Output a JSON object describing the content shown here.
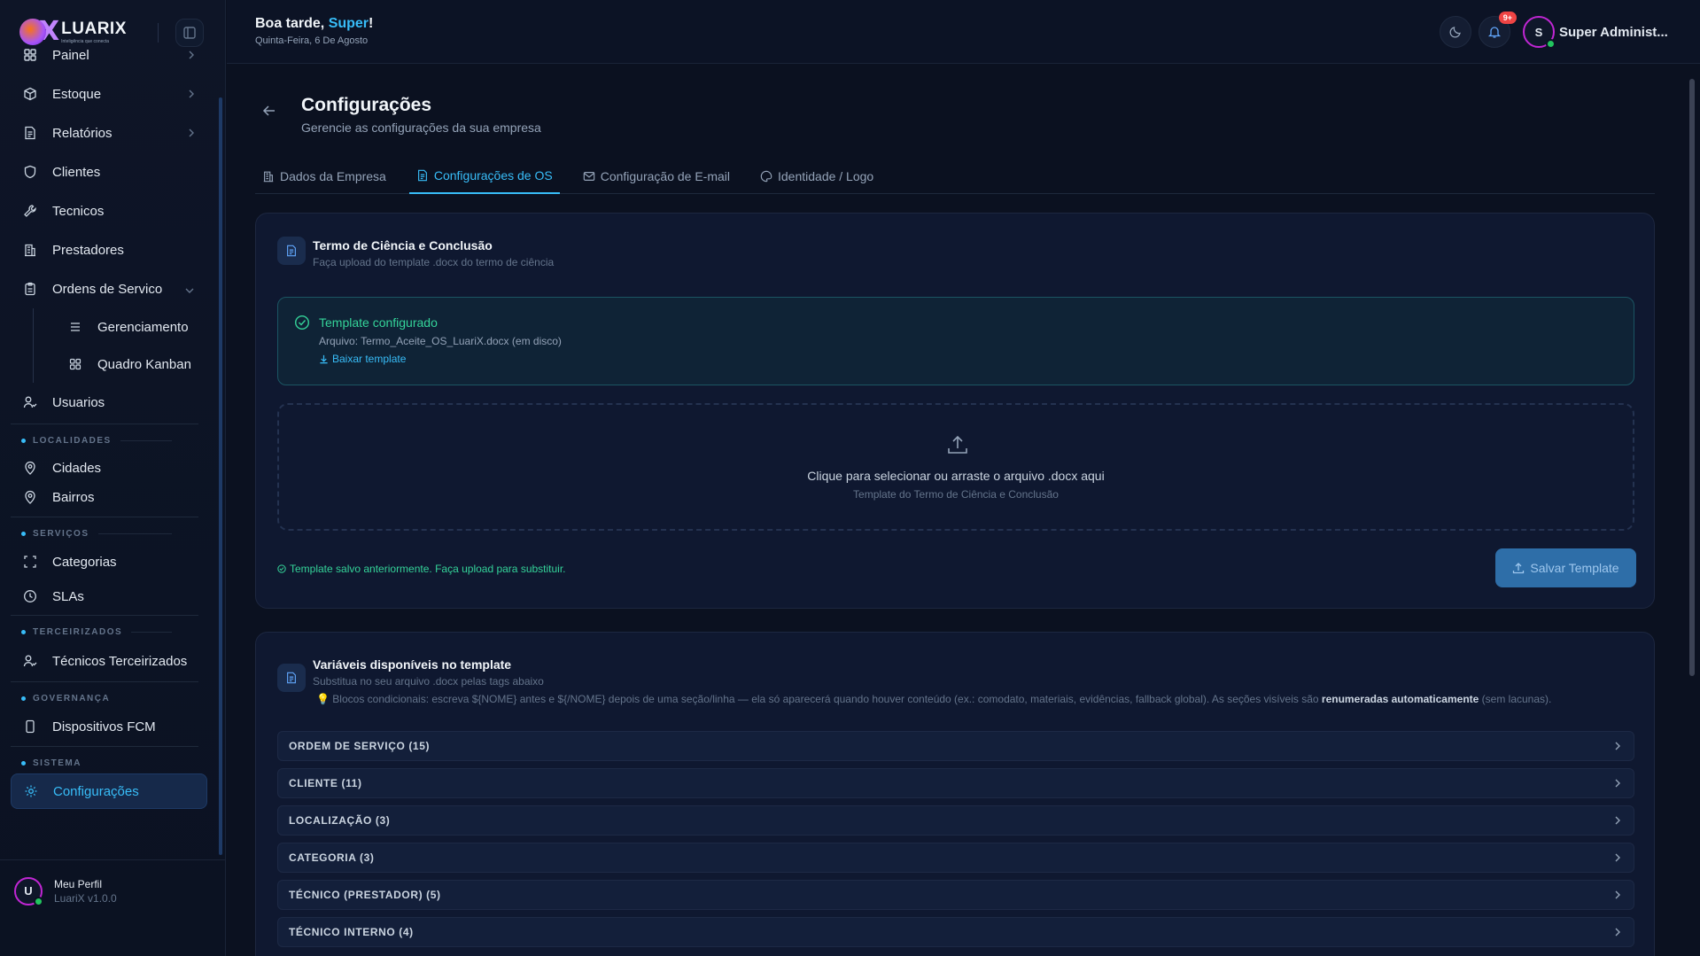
{
  "brand": {
    "name": "LUARIX",
    "tagline": "Inteligência que conecta"
  },
  "header": {
    "greeting_prefix": "Boa tarde, ",
    "greeting_name": "Super",
    "greeting_suffix": "!",
    "date": "Quinta-Feira, 6 De Agosto",
    "notifications_badge": "9+",
    "user_initial": "S",
    "user_name": "Super Administ..."
  },
  "sidebar": {
    "items_top": [
      {
        "label": "Painel",
        "icon": "grid-icon",
        "chevron": true
      },
      {
        "label": "Estoque",
        "icon": "package-icon",
        "chevron": true
      },
      {
        "label": "Relatórios",
        "icon": "file-icon",
        "chevron": true
      },
      {
        "label": "Clientes",
        "icon": "shield-icon"
      },
      {
        "label": "Tecnicos",
        "icon": "wrench-icon"
      },
      {
        "label": "Prestadores",
        "icon": "building-icon"
      },
      {
        "label": "Ordens de Servico",
        "icon": "clipboard-icon",
        "chevron": true
      }
    ],
    "sub_items": [
      {
        "label": "Gerenciamento",
        "icon": "list-icon"
      },
      {
        "label": "Quadro Kanban",
        "icon": "kanban-icon"
      }
    ],
    "usuarios": "Usuarios",
    "sections": {
      "localidades": "LOCALIDADES",
      "servicos": "SERVIÇOS",
      "terceirizados": "TERCEIRIZADOS",
      "governanca": "GOVERNANÇA",
      "sistema": "SISTEMA"
    },
    "cidades": "Cidades",
    "bairros": "Bairros",
    "categorias": "Categorias",
    "slas": "SLAs",
    "tecnicos_terceirizados": "Técnicos Terceirizados",
    "dispositivos": "Dispositivos FCM",
    "configuracoes": "Configurações",
    "profile": {
      "initial": "U",
      "name": "Meu Perfil",
      "version": "LuariX v1.0.0"
    }
  },
  "page": {
    "title": "Configurações",
    "subtitle": "Gerencie as configurações da sua empresa",
    "tabs": [
      {
        "label": "Dados da Empresa",
        "icon": "building-icon"
      },
      {
        "label": "Configurações de OS",
        "icon": "file-icon",
        "active": true
      },
      {
        "label": "Configuração de E-mail",
        "icon": "mail-icon"
      },
      {
        "label": "Identidade / Logo",
        "icon": "palette-icon"
      }
    ]
  },
  "template_card": {
    "title": "Termo de Ciência e Conclusão",
    "desc": "Faça upload do template .docx do termo de ciência",
    "status_title": "Template configurado",
    "file": "Arquivo: Termo_Aceite_OS_LuariX.docx (em disco)",
    "download": "Baixar template",
    "drop_main": "Clique para selecionar ou arraste o arquivo .docx aqui",
    "drop_sub": "Template do Termo de Ciência e Conclusão",
    "saved_note": "Template salvo anteriormente. Faça upload para substituir.",
    "save_button": "Salvar Template"
  },
  "vars_card": {
    "title": "Variáveis disponíveis no template",
    "desc": "Substitua no seu arquivo .docx pelas tags abaixo",
    "hint_before": "Blocos condicionais: escreva ${NOME} antes e ${/NOME} depois de uma seção/linha — ela só aparecerá quando houver conteúdo (ex.: comodato, materiais, evidências, fallback global). As seções visíveis são ",
    "hint_bold": "renumeradas automaticamente",
    "hint_after": " (sem lacunas).",
    "groups": [
      "ORDEM DE SERVIÇO (15)",
      "CLIENTE (11)",
      "LOCALIZAÇÃO (3)",
      "CATEGORIA (3)",
      "TÉCNICO (PRESTADOR) (5)",
      "TÉCNICO INTERNO (4)"
    ]
  },
  "colors": {
    "accent": "#38bdf8",
    "success": "#34d399",
    "background": "#0b1120"
  }
}
